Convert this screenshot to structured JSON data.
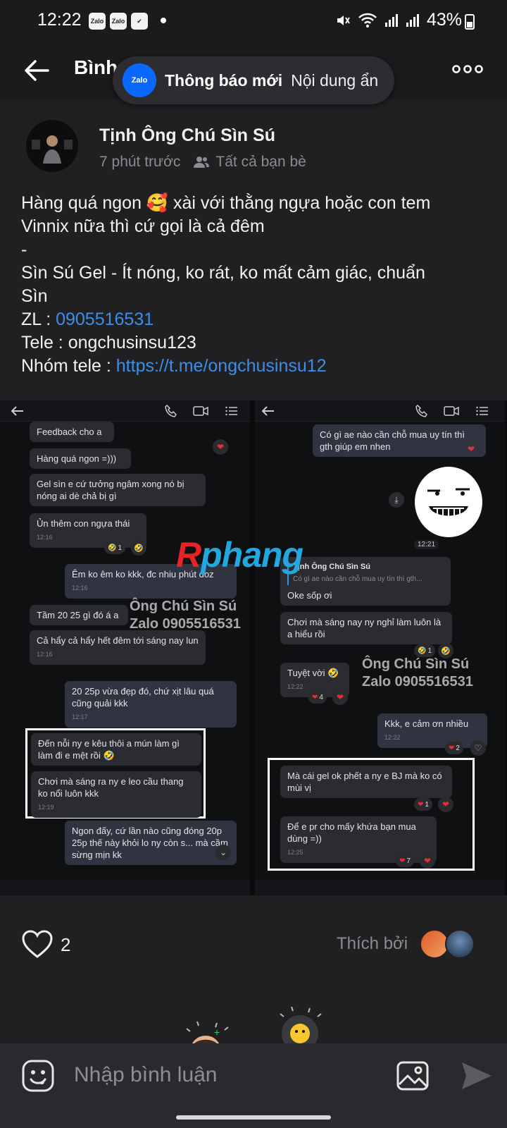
{
  "status_bar": {
    "time": "12:22",
    "app_icons": [
      "Zalo",
      "Zalo"
    ],
    "battery": "43%"
  },
  "header": {
    "title": "Bình"
  },
  "notification": {
    "app": "Zalo",
    "title": "Thông báo mới",
    "body": "Nội dung ẩn"
  },
  "post": {
    "author": "Tịnh Ông Chú Sìn Sú",
    "time_ago": "7 phút trước",
    "audience": "Tất cả bạn bè",
    "lines": {
      "l1": "Hàng quá ngon 🥰 xài với thằng ngựa hoặc con tem",
      "l2": "Vinnix nữa thì cứ gọi là cả đêm",
      "l3": "-",
      "l4": "Sìn Sú Gel - Ít nóng, ko rát, ko mất cảm giác, chuẩn",
      "l5": "Sìn",
      "zl_label": "ZL : ",
      "zl_phone": "0905516531",
      "tele_line": "Tele : ongchusinsu123",
      "group_label": "Nhóm tele : ",
      "group_link": "https://t.me/ongchusinsu12"
    }
  },
  "screenshot_left": {
    "messages": [
      {
        "text": "Feedback cho a",
        "time": ""
      },
      {
        "text": "Hàng quá ngon =)))",
        "time": ""
      },
      {
        "text": "Gel sìn e cứ tưởng ngâm xong nó bị nóng ai dè chả bị gì",
        "time": ""
      },
      {
        "text": "Ủn thêm con ngựa thái",
        "time": "12:16"
      },
      {
        "text": "Êm ko êm ko kkk, đc nhiu phút đoz",
        "time": "12:16"
      },
      {
        "text": "Tầm 20 25 gì đó á a",
        "time": ""
      },
      {
        "text": "Cả hẩy cả hẩy hết đêm tới sáng nay lun",
        "time": "12:16"
      },
      {
        "text": "20 25p vừa đẹp đó, chứ xịt lâu quá cũng quải kkk",
        "time": "12:17"
      },
      {
        "text": "Đến nỗi ny e kêu thôi a mún làm gì làm đi e mệt rồi 🤣",
        "time": ""
      },
      {
        "text": "Chơi mà sáng ra ny e leo cầu thang ko nổi luôn kkk",
        "time": "12:19"
      },
      {
        "text": "Ngon đấy, cứ lần nào cũng đóng 20p 25p thế này khỏi lo ny còn s... mà cầm sừng mịn kk",
        "time": ""
      }
    ],
    "reaction_count": "1",
    "watermark_line1": "Ông Chú Sìn Sú",
    "watermark_line2": "Zalo 0905516531"
  },
  "screenshot_right": {
    "messages": [
      {
        "text": "Có gì ae nào cần chỗ mua uy tín thì gth giúp em nhen",
        "time": ""
      },
      {
        "text": "Oke sốp ơi",
        "time": ""
      },
      {
        "text": "Chơi mà sáng nay ny nghỉ làm luôn là a hiểu rồi",
        "time": ""
      },
      {
        "text": "Tuyệt vời 🤣",
        "time": "12:22"
      },
      {
        "text": "Kkk, e cảm ơn nhiều",
        "time": "12:22"
      },
      {
        "text": "Mà cái gel ok phết a ny e BJ mà ko có mùi vị",
        "time": ""
      },
      {
        "text": "Để e pr cho mấy khứa bạn mua dùng =))",
        "time": "12:25"
      }
    ],
    "sticker_time": "12:21",
    "quote_author": "Tịnh Ông Chú Sìn Sú",
    "quote_text": "Có gì ae nào cần chỗ mua uy tín thì gth...",
    "reaction_counts": [
      "1",
      "4",
      "2",
      "1",
      "7"
    ],
    "watermark_line1": "Ông Chú Sìn Sú",
    "watermark_line2": "Zalo 0905516531"
  },
  "logo_watermark": {
    "part1": "R",
    "part2": "phang"
  },
  "likes": {
    "count": "2",
    "liked_by_label": "Thích bởi"
  },
  "comment": {
    "placeholder": "Nhập bình luận"
  },
  "icons": {
    "back": "arrow-left-icon",
    "more": "more-horizontal-icon",
    "friends": "friends-icon",
    "heart": "heart-outline-icon",
    "emoji": "emoji-icon",
    "image": "image-icon",
    "send": "send-icon"
  },
  "colors": {
    "background": "#202023",
    "link": "#3b8fe8",
    "zalo_blue": "#0b68ff",
    "heart_red": "#e2303a"
  }
}
